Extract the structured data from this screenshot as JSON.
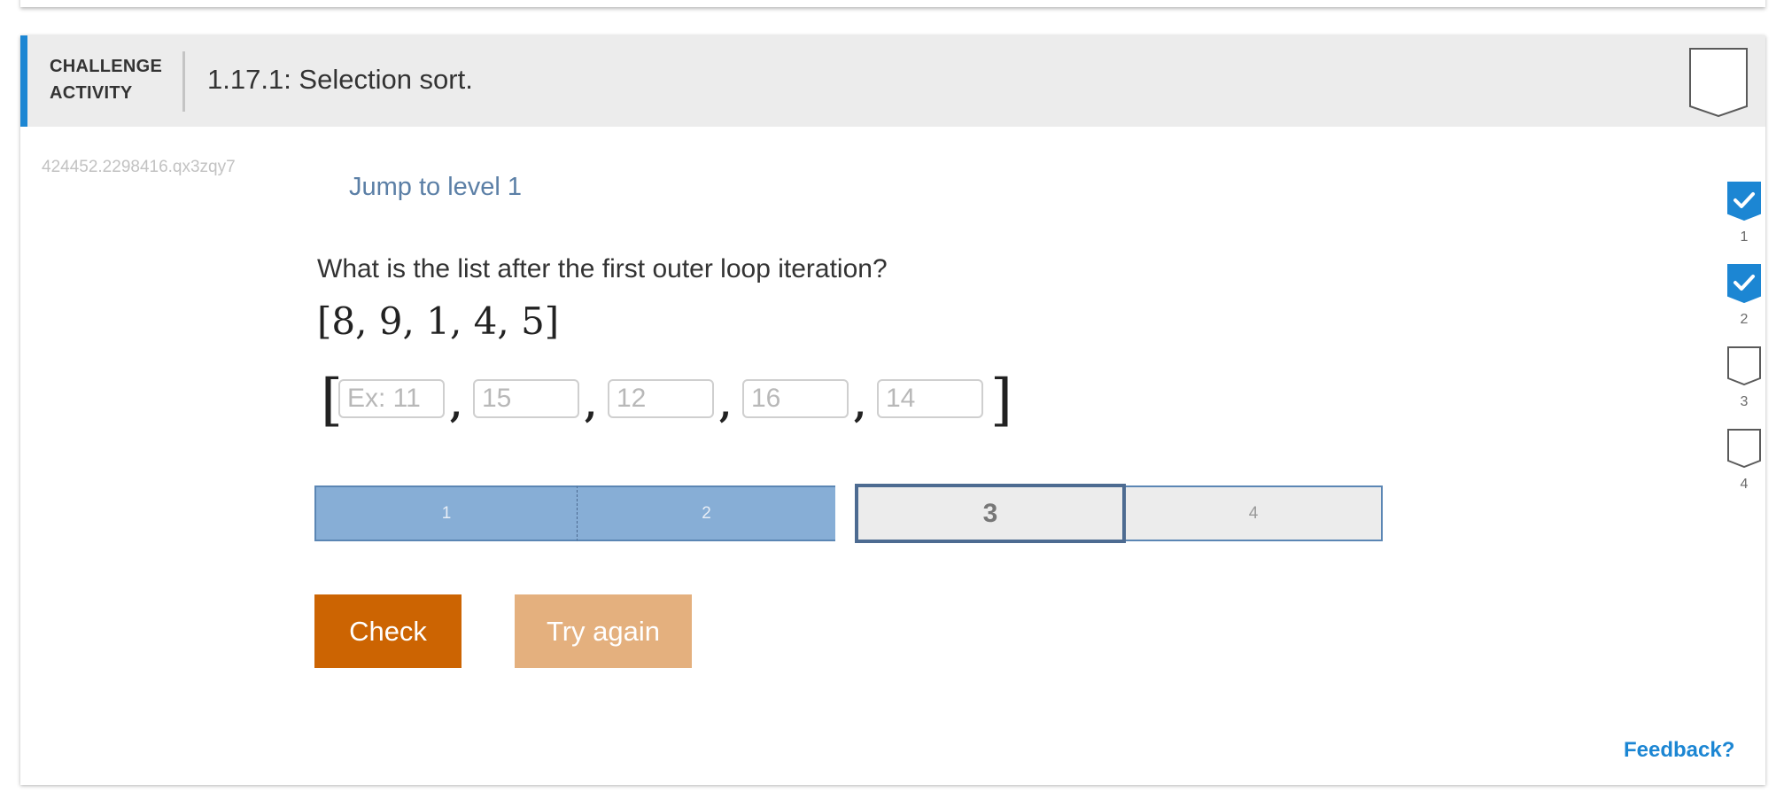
{
  "header": {
    "kind_line1": "CHALLENGE",
    "kind_line2": "ACTIVITY",
    "title": "1.17.1: Selection sort."
  },
  "activity_id": "424452.2298416.qx3zqy7",
  "jump_link": "Jump to level 1",
  "question": "What is the list after the first outer loop iteration?",
  "given_list": "[8, 9, 1, 4, 5]",
  "answer": {
    "bracket_open": "[",
    "bracket_close": "]",
    "separator": ",",
    "inputs": [
      {
        "placeholder": "Ex: 11",
        "value": ""
      },
      {
        "placeholder": "15",
        "value": ""
      },
      {
        "placeholder": "12",
        "value": ""
      },
      {
        "placeholder": "16",
        "value": ""
      },
      {
        "placeholder": "14",
        "value": ""
      }
    ]
  },
  "levels": [
    {
      "label": "1",
      "state": "done"
    },
    {
      "label": "2",
      "state": "done"
    },
    {
      "label": "3",
      "state": "current"
    },
    {
      "label": "4",
      "state": "todo"
    }
  ],
  "buttons": {
    "check": "Check",
    "try_again": "Try again"
  },
  "side_levels": [
    {
      "label": "1",
      "completed": true
    },
    {
      "label": "2",
      "completed": true
    },
    {
      "label": "3",
      "completed": false
    },
    {
      "label": "4",
      "completed": false
    }
  ],
  "feedback": "Feedback?",
  "colors": {
    "accent": "#1c86d3",
    "check_button": "#cc6402",
    "try_again_button": "#e4b07e",
    "level_done": "#87aed6",
    "level_current_border": "#4d6b91"
  }
}
